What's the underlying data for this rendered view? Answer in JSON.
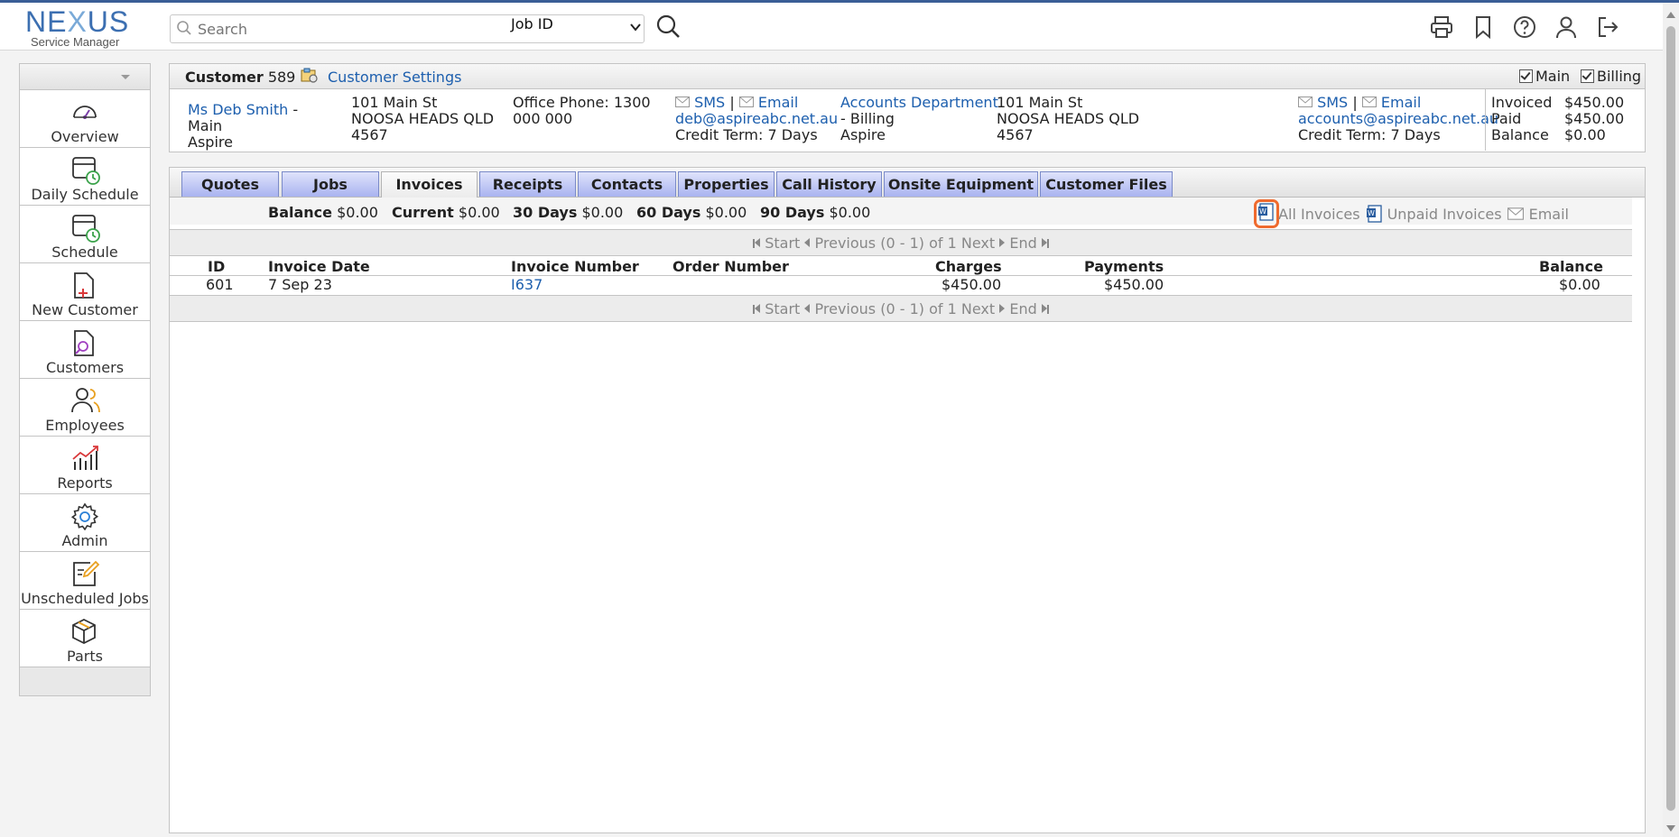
{
  "app": {
    "logo_top": "NE",
    "logo_x": "X",
    "logo_tail": "US",
    "logo_sub": "Service Manager"
  },
  "search": {
    "placeholder": "Search",
    "type_selected": "Job ID"
  },
  "sidebar": {
    "items": [
      {
        "label": "Overview",
        "icon": "gauge-icon"
      },
      {
        "label": "Daily Schedule",
        "icon": "calendar-clock-icon"
      },
      {
        "label": "Schedule",
        "icon": "calendar-clock-icon"
      },
      {
        "label": "New Customer",
        "icon": "file-plus-icon"
      },
      {
        "label": "Customers",
        "icon": "file-search-icon"
      },
      {
        "label": "Employees",
        "icon": "users-icon"
      },
      {
        "label": "Reports",
        "icon": "chart-icon"
      },
      {
        "label": "Admin",
        "icon": "gear-icon"
      },
      {
        "label": "Unscheduled Jobs",
        "icon": "edit-note-icon"
      },
      {
        "label": "Parts",
        "icon": "box-icon"
      }
    ]
  },
  "customer": {
    "title_label": "Customer",
    "id": "589",
    "settings_label": "Customer Settings",
    "main_label": "Main",
    "billing_label": "Billing",
    "main_contact": {
      "name": "Ms Deb Smith",
      "role": "- Main",
      "company": "Aspire",
      "address1": "101 Main St",
      "address2": "NOOSA HEADS QLD",
      "postcode": "4567",
      "phone_line1": "Office Phone: 1300",
      "phone_line2": "000 000",
      "sms": "SMS",
      "sep": "|",
      "email_label": "Email",
      "email": "deb@aspireabc.net.au",
      "credit": "Credit Term: 7 Days"
    },
    "billing_contact": {
      "name": "Accounts Department",
      "role": "- Billing",
      "company": "Aspire",
      "address1": "101 Main St",
      "address2": "NOOSA HEADS QLD",
      "postcode": "4567",
      "sms": "SMS",
      "sep": "|",
      "email_label": "Email",
      "email": "accounts@aspireabc.net.au",
      "credit": "Credit Term: 7 Days"
    },
    "totals": {
      "invoiced_label": "Invoiced",
      "invoiced": "$450.00",
      "paid_label": "Paid",
      "paid": "$450.00",
      "balance_label": "Balance",
      "balance": "$0.00"
    }
  },
  "tabs": [
    "Quotes",
    "Jobs",
    "Invoices",
    "Receipts",
    "Contacts",
    "Properties",
    "Call History",
    "Onsite Equipment",
    "Customer Files"
  ],
  "active_tab": "Invoices",
  "aging": {
    "balance_label": "Balance",
    "balance": "$0.00",
    "current_label": "Current",
    "current": "$0.00",
    "d30_label": "30 Days",
    "d30": "$0.00",
    "d60_label": "60 Days",
    "d60": "$0.00",
    "d90_label": "90 Days",
    "d90": "$0.00"
  },
  "actions": {
    "all_invoices": "All Invoices",
    "unpaid_invoices": "Unpaid Invoices",
    "email": "Email"
  },
  "pager": {
    "start": "Start",
    "previous": "Previous",
    "range": "(0 - 1) of 1",
    "next": "Next",
    "end": "End"
  },
  "table": {
    "headers": {
      "id": "ID",
      "date": "Invoice Date",
      "number": "Invoice Number",
      "order": "Order Number",
      "charges": "Charges",
      "payments": "Payments",
      "balance": "Balance"
    },
    "rows": [
      {
        "id": "601",
        "date": "7 Sep 23",
        "number": "I637",
        "order": "",
        "charges": "$450.00",
        "payments": "$450.00",
        "balance": "$0.00"
      }
    ]
  }
}
